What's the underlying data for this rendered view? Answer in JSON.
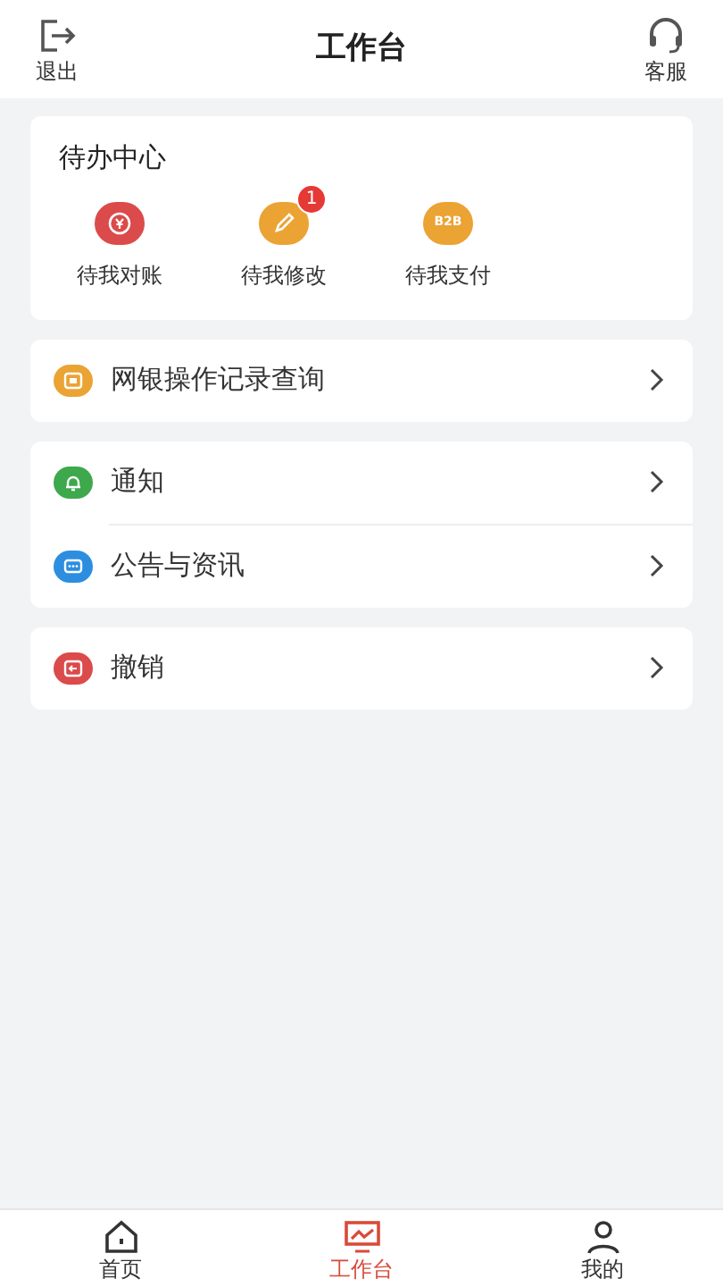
{
  "header": {
    "left": {
      "label": "退出"
    },
    "title": "工作台",
    "right": {
      "label": "客服"
    }
  },
  "todo": {
    "title": "待办中心",
    "items": [
      {
        "kind": "reconcile",
        "label": "待我对账",
        "color": "#db4b4b"
      },
      {
        "kind": "edit",
        "label": "待我修改",
        "color": "#eba334",
        "badge": "1"
      },
      {
        "kind": "pay",
        "label": "待我支付",
        "color": "#eba334",
        "icon_text": "B2B"
      }
    ]
  },
  "menu_groups": [
    [
      {
        "kind": "record",
        "label": "网银操作记录查询",
        "color": "#eba334"
      }
    ],
    [
      {
        "kind": "bell",
        "label": "通知",
        "color": "#3ea84c"
      },
      {
        "kind": "chat",
        "label": "公告与资讯",
        "color": "#2d8ee0"
      }
    ],
    [
      {
        "kind": "revoke",
        "label": "撤销",
        "color": "#db4b4b"
      }
    ]
  ],
  "tab_bar": [
    {
      "kind": "home",
      "label": "首页",
      "selected": false
    },
    {
      "kind": "desk",
      "label": "工作台",
      "selected": true
    },
    {
      "kind": "me",
      "label": "我的",
      "selected": false
    }
  ]
}
